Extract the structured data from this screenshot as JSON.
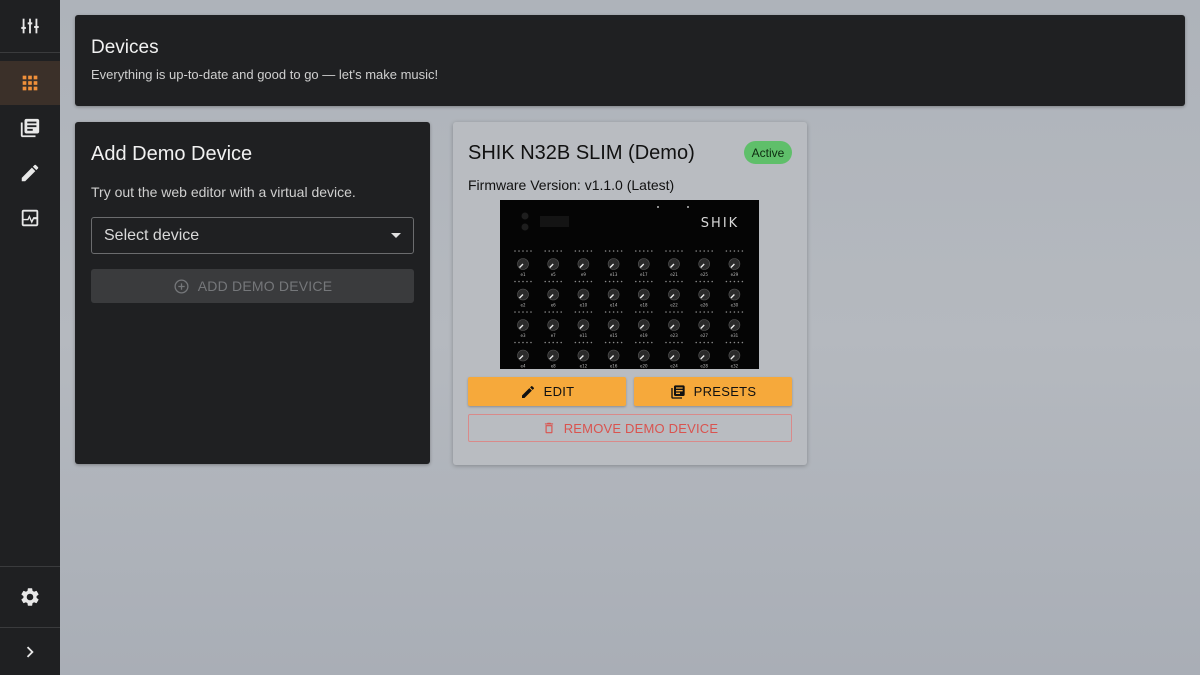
{
  "sidebar": {
    "items": [
      {
        "icon": "mixer-icon"
      },
      {
        "icon": "grid-icon",
        "active": true
      },
      {
        "icon": "library-icon"
      },
      {
        "icon": "pencil-icon"
      },
      {
        "icon": "monitor-pulse-icon"
      }
    ],
    "bottom": [
      {
        "icon": "gear-icon"
      },
      {
        "icon": "chevron-right-icon"
      }
    ],
    "accent": "#f0903a"
  },
  "header": {
    "title": "Devices",
    "subtitle": "Everything is up-to-date and good to go — let's make music!"
  },
  "add_demo": {
    "title": "Add Demo Device",
    "subtitle": "Try out the web editor with a virtual device.",
    "select_placeholder": "Select device",
    "button_label": "ADD DEMO DEVICE"
  },
  "device": {
    "name": "SHIK N32B SLIM (Demo)",
    "status": "Active",
    "firmware": "Firmware Version: v1.1.0 (Latest)",
    "logo_text": "SHIK",
    "knob_labels": [
      [
        "e1",
        "e5",
        "e9",
        "e13",
        "e17",
        "e21",
        "e25",
        "e29"
      ],
      [
        "e2",
        "e6",
        "e10",
        "e14",
        "e18",
        "e22",
        "e26",
        "e30"
      ],
      [
        "e3",
        "e7",
        "e11",
        "e15",
        "e19",
        "e23",
        "e27",
        "e31"
      ],
      [
        "e4",
        "e8",
        "e12",
        "e16",
        "e20",
        "e24",
        "e28",
        "e32"
      ]
    ],
    "edit_label": "EDIT",
    "presets_label": "PRESETS",
    "remove_label": "REMOVE DEMO DEVICE"
  },
  "colors": {
    "primary_button": "#f6a93b",
    "danger": "#d9534f",
    "status_badge": "#5fbf6a"
  }
}
